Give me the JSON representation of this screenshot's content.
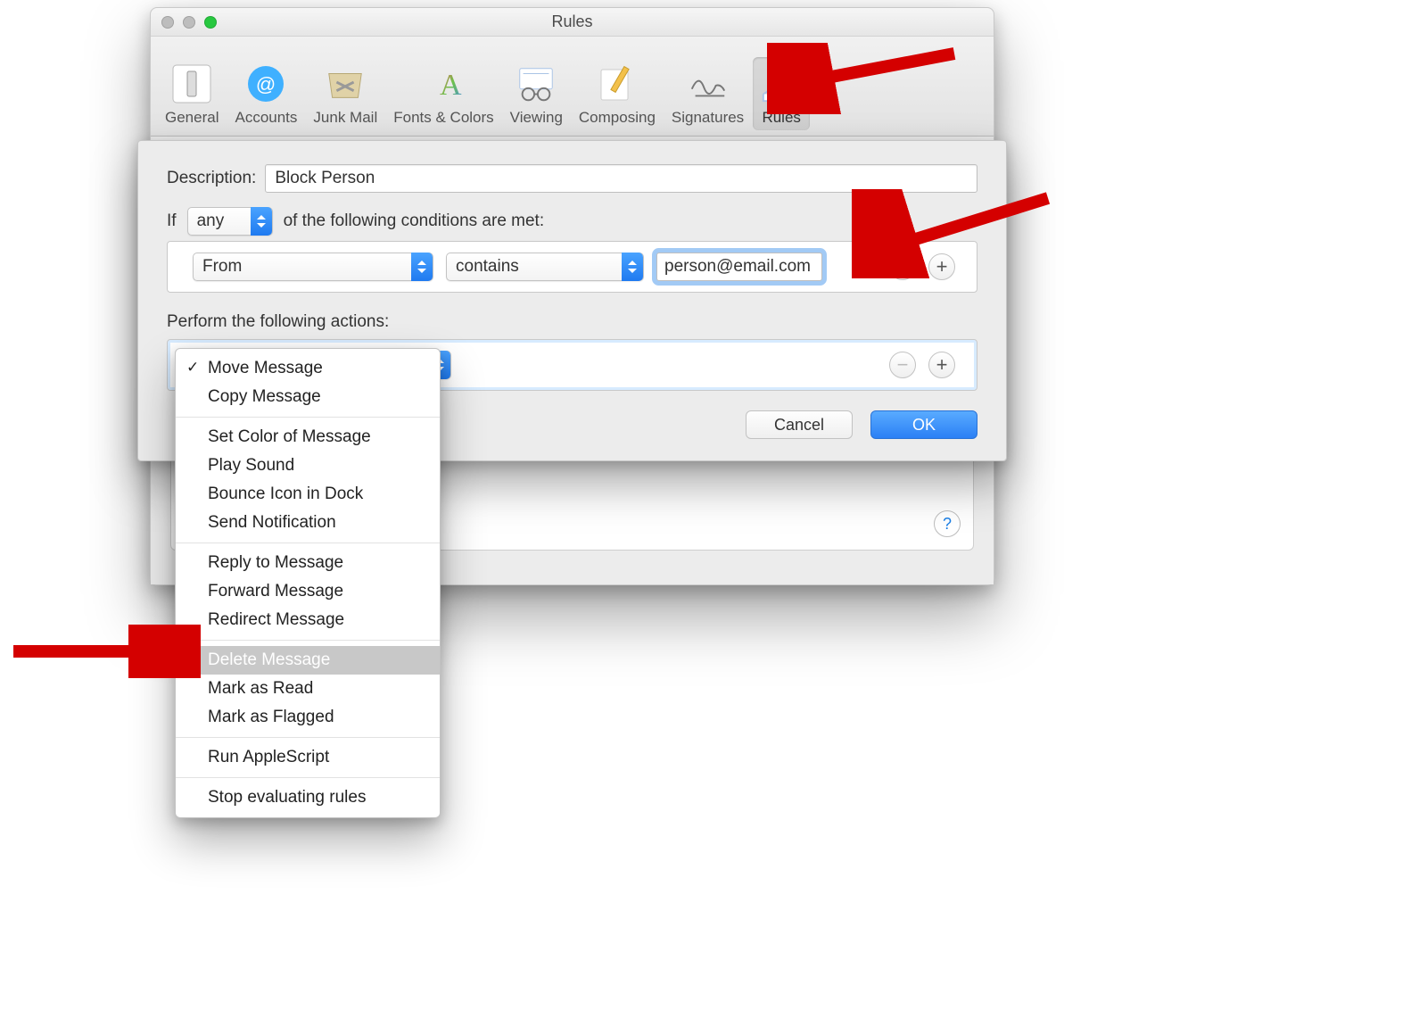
{
  "window": {
    "title": "Rules"
  },
  "toolbar": {
    "tabs": [
      {
        "label": "General"
      },
      {
        "label": "Accounts"
      },
      {
        "label": "Junk Mail"
      },
      {
        "label": "Fonts & Colors"
      },
      {
        "label": "Viewing"
      },
      {
        "label": "Composing"
      },
      {
        "label": "Signatures"
      },
      {
        "label": "Rules"
      }
    ],
    "activeIndex": 7
  },
  "help": "?",
  "sheet": {
    "descLabel": "Description:",
    "descValue": "Block Person",
    "ifLabel": "If",
    "anyValue": "any",
    "conditionsTail": "of the following conditions are met:",
    "condition": {
      "field": "From",
      "op": "contains",
      "value": "person@email.com"
    },
    "actionsHeader": "Perform the following actions:",
    "minus": "−",
    "plus": "+",
    "cancel": "Cancel",
    "ok": "OK"
  },
  "popup": {
    "checkedIndex": 0,
    "highlightIndex": 9,
    "groups": [
      [
        "Move Message",
        "Copy Message"
      ],
      [
        "Set Color of Message",
        "Play Sound",
        "Bounce Icon in Dock",
        "Send Notification"
      ],
      [
        "Reply to Message",
        "Forward Message",
        "Redirect Message"
      ],
      [
        "Delete Message",
        "Mark as Read",
        "Mark as Flagged"
      ],
      [
        "Run AppleScript"
      ],
      [
        "Stop evaluating rules"
      ]
    ]
  }
}
